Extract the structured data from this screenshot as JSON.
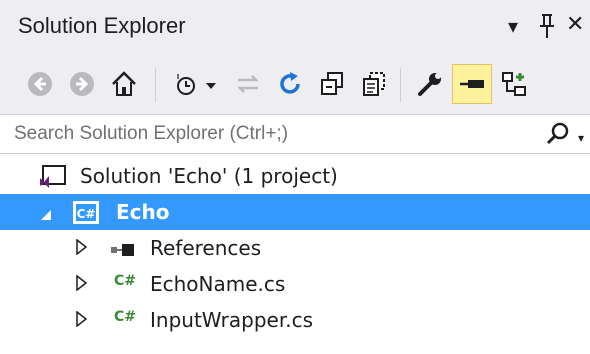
{
  "panel": {
    "title": "Solution Explorer",
    "controls": {
      "dropdown_glyph": "▾",
      "pin_glyph": "⊥",
      "close_glyph": "✕"
    }
  },
  "toolbar": {
    "buttons": [
      {
        "name": "back-icon"
      },
      {
        "name": "forward-icon"
      },
      {
        "name": "home-icon"
      },
      {
        "name": "pending-changes-filter-icon"
      },
      {
        "name": "sync-with-active-document-icon"
      },
      {
        "name": "refresh-icon"
      },
      {
        "name": "collapse-all-icon"
      },
      {
        "name": "show-all-files-icon"
      },
      {
        "name": "properties-icon"
      },
      {
        "name": "preview-selected-items-icon",
        "active": true
      },
      {
        "name": "view-class-diagram-icon"
      }
    ]
  },
  "search": {
    "placeholder": "Search Solution Explorer (Ctrl+;)"
  },
  "tree": {
    "solution_label": "Solution 'Echo' (1 project)",
    "project_label": "Echo",
    "items": [
      {
        "label": "References",
        "icon": "references-icon"
      },
      {
        "label": "EchoName.cs",
        "icon": "csharp-file-icon"
      },
      {
        "label": "InputWrapper.cs",
        "icon": "csharp-file-icon"
      }
    ],
    "cs_glyph": "C#"
  },
  "colors": {
    "selection": "#3399ff",
    "chrome": "#eeeef2",
    "active_button": "#fff29d",
    "vs_purple": "#68217a",
    "csharp_green": "#388a34",
    "refresh_blue": "#1e74d6"
  }
}
